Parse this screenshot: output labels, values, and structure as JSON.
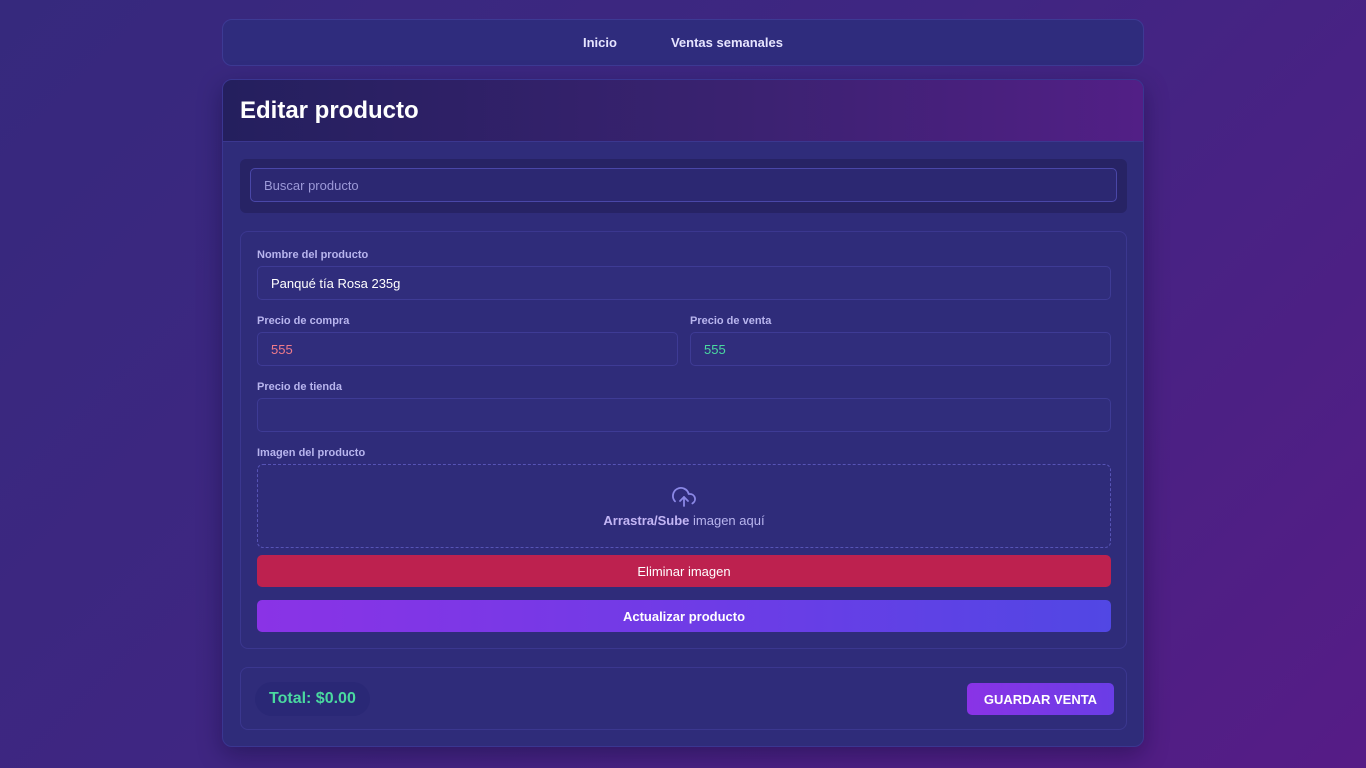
{
  "nav": {
    "items": [
      {
        "label": "Inicio"
      },
      {
        "label": "Ventas semanales"
      }
    ]
  },
  "page": {
    "title": "Editar producto"
  },
  "search": {
    "placeholder": "Buscar producto",
    "value": ""
  },
  "form": {
    "name_label": "Nombre del producto",
    "name_value": "Panqué tía Rosa 235g",
    "purchase_label": "Precio de compra",
    "purchase_value": "555",
    "sale_label": "Precio de venta",
    "sale_value": "555",
    "store_label": "Precio de tienda",
    "store_value": "",
    "image_label": "Imagen del producto",
    "dropzone_strong": "Arrastra/Sube",
    "dropzone_text": " imagen aquí",
    "dropzone_icon": "cloud-upload-icon",
    "delete_image_label": "Eliminar imagen",
    "update_label": "Actualizar producto"
  },
  "footer": {
    "total_label": "Total: $0.00",
    "save_label": "GUARDAR VENTA"
  },
  "colors": {
    "danger": "#bd214f",
    "accent_start": "#8a33e6",
    "accent_end": "#5147e4",
    "price_buy": "#f07b8a",
    "price_sell": "#4ad9a0",
    "total": "#4ad9a0"
  }
}
